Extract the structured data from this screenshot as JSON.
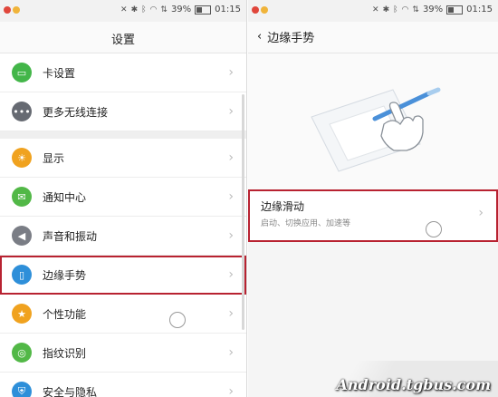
{
  "status": {
    "battery": "39%",
    "time": "01:15",
    "battery_level": 0.39
  },
  "left": {
    "title": "设置",
    "groups": [
      [
        {
          "label": "卡设置",
          "icon": "sim-card-icon",
          "color": "#43b649"
        },
        {
          "label": "更多无线连接",
          "icon": "more-icon",
          "color": "#666a72"
        }
      ],
      [
        {
          "label": "显示",
          "icon": "sun-icon",
          "color": "#f0a21f"
        },
        {
          "label": "通知中心",
          "icon": "chat-icon",
          "color": "#52b847"
        },
        {
          "label": "声音和振动",
          "icon": "speaker-icon",
          "color": "#7a7d85"
        },
        {
          "label": "边缘手势",
          "icon": "phone-edge-icon",
          "color": "#2e8fd9"
        },
        {
          "label": "个性功能",
          "icon": "star-box-icon",
          "color": "#f0a21f"
        },
        {
          "label": "指纹识别",
          "icon": "fingerprint-icon",
          "color": "#52b847"
        },
        {
          "label": "安全与隐私",
          "icon": "shield-icon",
          "color": "#2e8fd9"
        }
      ]
    ]
  },
  "right": {
    "back_label": "边缘手势",
    "item_title": "边缘滑动",
    "item_subtitle": "启动、切换应用、加速等"
  },
  "watermark": "Android.tgbus.com"
}
